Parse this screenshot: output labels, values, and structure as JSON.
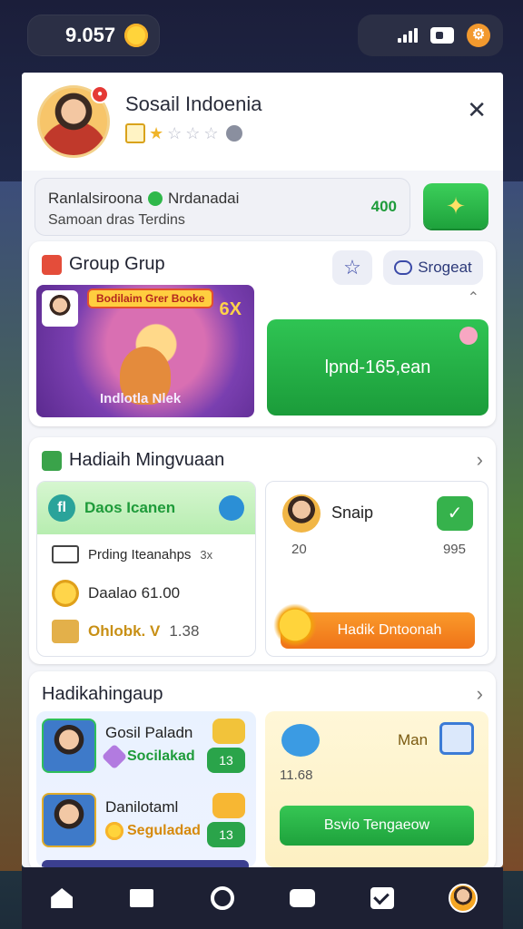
{
  "status_bar": {
    "coins": "9.057",
    "icons": [
      "sun-icon",
      "signal-icon",
      "wifi-icon",
      "settings-icon"
    ]
  },
  "profile": {
    "name": "Sosail Indoenia",
    "rating_filled": 1,
    "rating_total": 4
  },
  "promo": {
    "line1_a": "Ranlalsiroona",
    "line1_b": "Nrdanadai",
    "line2": "Samoan dras Terdins",
    "value": "400"
  },
  "group": {
    "title": "Group Grup",
    "share_label": "Srogeat",
    "event_banner": "Bodilaim Grer Booke",
    "event_multiplier": "6X",
    "event_label": "Indlotla Nlek",
    "green_button": "lpnd-165,ean"
  },
  "weekly": {
    "title": "Hadiaih Mingvuaan",
    "left_header": "Daos Icanen",
    "left_header_badge": "fl",
    "row1": "Prding Iteanahps",
    "row1_suffix": "3x",
    "row2": "Daalao 61.00",
    "row3_a": "Ohlobk. V",
    "row3_b": "1.38",
    "right_name": "Snaip",
    "right_num1": "20",
    "right_num2": "995",
    "right_button": "Hadik Dntoonah"
  },
  "hadiah2": {
    "title": "Hadikahingaup",
    "row1_title": "Gosil Paladn",
    "row1_sub": "Socilakad",
    "row1_pill": "13",
    "row2_title": "Danilotaml",
    "row2_sub": "Seguladad",
    "row2_pill": "13",
    "right_label": "Man",
    "right_num": "11.68",
    "right_button": "Bsvio Tengaeow"
  },
  "nav": {
    "items": [
      "home-icon",
      "folder-icon",
      "search-icon",
      "game-icon",
      "check-icon",
      "avatar"
    ]
  },
  "colors": {
    "primary_green": "#2fc453",
    "accent_orange": "#f2802a",
    "dark_bg": "#1d2033"
  }
}
